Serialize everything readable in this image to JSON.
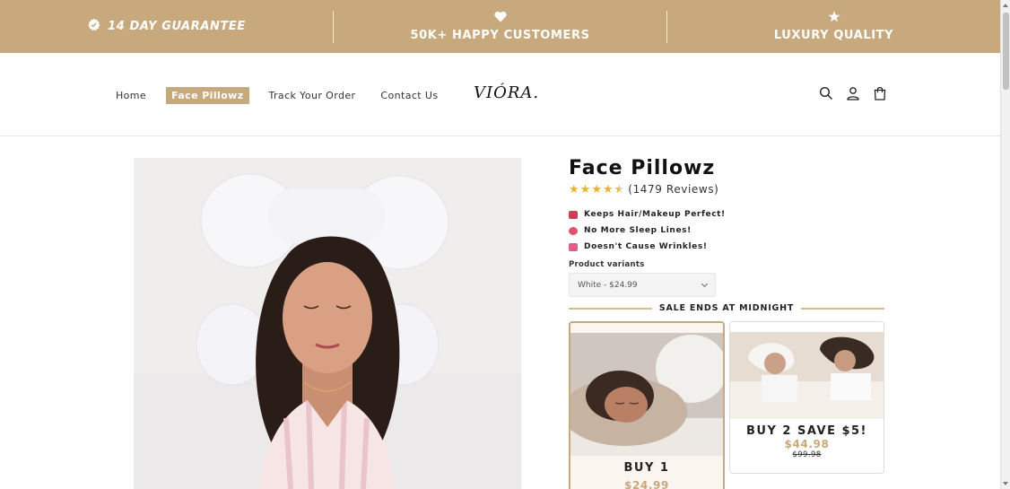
{
  "announcement": {
    "items": [
      {
        "icon": "badge-check-icon",
        "text": "14 DAY GUARANTEE"
      },
      {
        "icon": "heart-icon",
        "text": "50K+ HAPPY CUSTOMERS"
      },
      {
        "icon": "star-icon",
        "text": "LUXURY QUALITY"
      }
    ],
    "background": "#c8a97e"
  },
  "header": {
    "nav": [
      {
        "label": "Home",
        "active": false
      },
      {
        "label": "Face Pillowz",
        "active": true
      },
      {
        "label": "Track Your Order",
        "active": false
      },
      {
        "label": "Contact Us",
        "active": false
      }
    ],
    "logo": "VIÓRA.",
    "icons": [
      "search-icon",
      "account-icon",
      "cart-icon"
    ]
  },
  "product": {
    "title": "Face Pillowz",
    "rating": 4.5,
    "reviews": "(1479 Reviews)",
    "bullets": [
      {
        "icon": "bow-icon",
        "color": "#d43a57",
        "text": "Keeps Hair/Makeup Perfect!"
      },
      {
        "icon": "heart-face-icon",
        "color": "#e0526e",
        "text": "No More Sleep Lines!"
      },
      {
        "icon": "heart-arrow-icon",
        "color": "#e05b8a",
        "text": "Doesn't Cause Wrinkles!"
      }
    ],
    "variants_label": "Product variants",
    "variant_selected": "White - $24.99",
    "sale_text": "SALE ENDS AT MIDNIGHT",
    "offers": [
      {
        "name": "BUY 1",
        "price": "$24.99",
        "old_price": "",
        "selected": true
      },
      {
        "name": "BUY 2 SAVE $5!",
        "price": "$44.98",
        "old_price": "$99.98",
        "selected": false
      }
    ]
  },
  "colors": {
    "accent": "#c8a97e",
    "star": "#e7b52b"
  }
}
